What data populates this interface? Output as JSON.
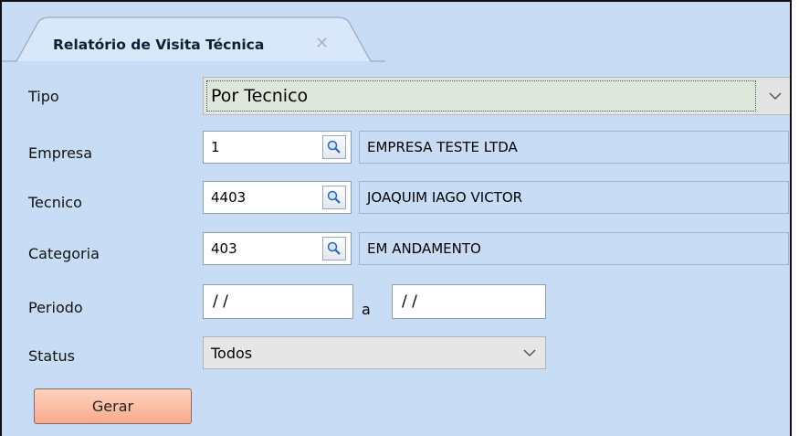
{
  "tab": {
    "title": "Relatório de Visita Técnica",
    "close_glyph": "✕"
  },
  "form": {
    "tipo": {
      "label": "Tipo",
      "value": "Por Tecnico"
    },
    "empresa": {
      "label": "Empresa",
      "code": "1",
      "name": "EMPRESA TESTE LTDA"
    },
    "tecnico": {
      "label": "Tecnico",
      "code": "4403",
      "name": "JOAQUIM IAGO VICTOR"
    },
    "categoria": {
      "label": "Categoria",
      "code": "403",
      "name": "EM ANDAMENTO"
    },
    "periodo": {
      "label": "Periodo",
      "start": "/ /",
      "separator": "a",
      "end": "/ /"
    },
    "status": {
      "label": "Status",
      "value": "Todos"
    }
  },
  "actions": {
    "gerar_label": "Gerar"
  },
  "icons": {
    "lookup": "magnifier-icon",
    "dropdown": "chevron-down-icon",
    "close": "close-icon"
  },
  "colors": {
    "panel": "#c9dcf6",
    "button_top": "#ffd3bf",
    "button_bottom": "#f9a98c"
  }
}
